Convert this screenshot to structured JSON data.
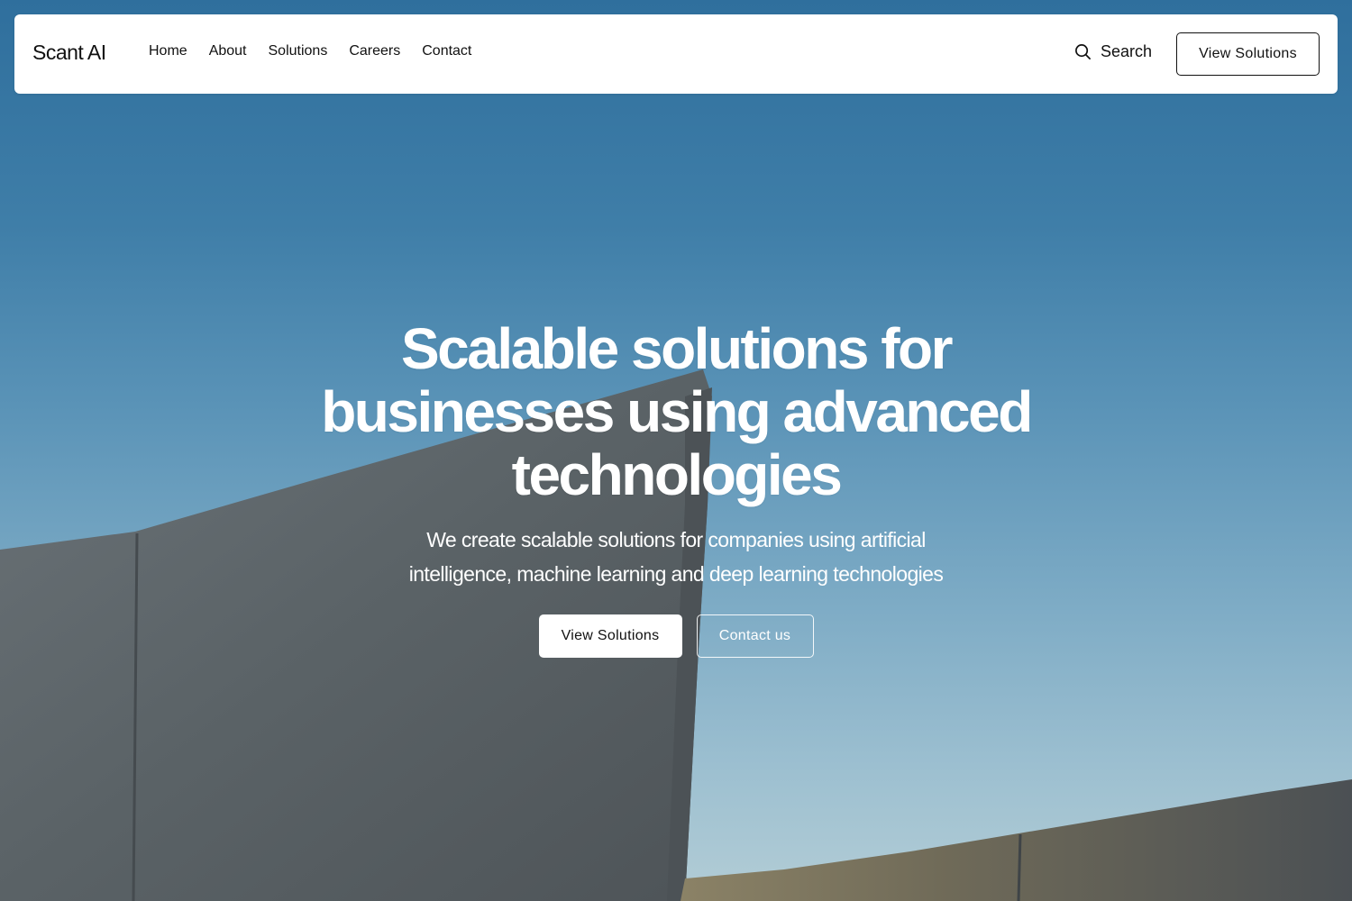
{
  "brand": {
    "name": "Scant AI"
  },
  "nav": {
    "links": [
      "Home",
      "About",
      "Solutions",
      "Careers",
      "Contact"
    ],
    "search_label": "Search",
    "search_icon": "search-icon",
    "cta_label": "View Solutions"
  },
  "hero": {
    "title": "Scalable solutions for businesses using advanced technologies",
    "subtitle": "We create scalable solutions for companies using artificial intelligence, machine learning and deep learning technologies",
    "primary_button": "View Solutions",
    "secondary_button": "Contact us"
  },
  "colors": {
    "sky_top": "#2f6f9d",
    "sky_bottom": "#b3cdd6",
    "concrete": "#5f6569",
    "navbar_bg": "#ffffff",
    "text_dark": "#111111"
  }
}
